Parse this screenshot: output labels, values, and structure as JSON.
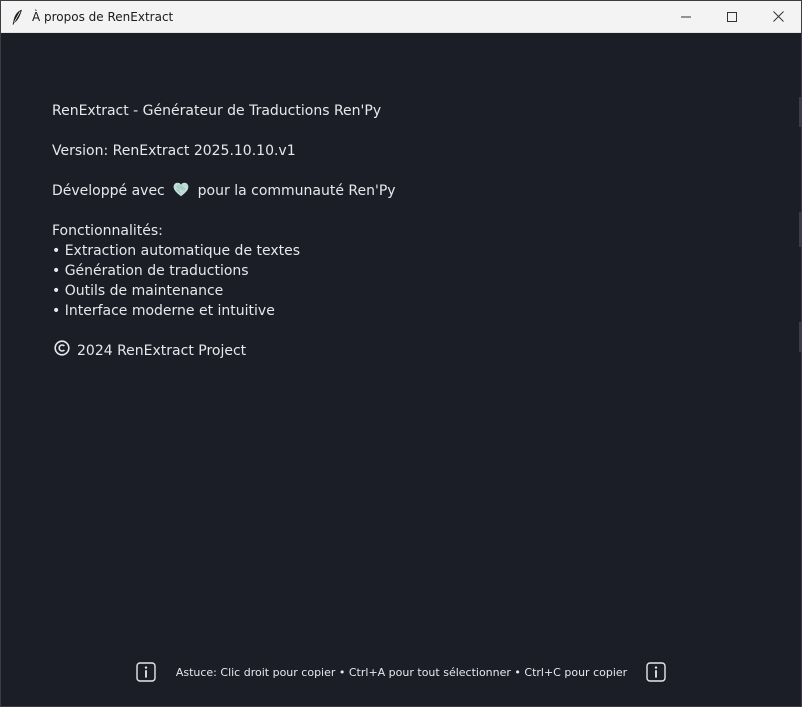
{
  "window": {
    "title": "À propos de RenExtract"
  },
  "about": {
    "heading": "RenExtract - Générateur de Traductions Ren'Py",
    "version": "Version: RenExtract 2025.10.10.v1",
    "dev_prefix": "Développé avec",
    "dev_suffix": "pour la communauté Ren'Py",
    "features_title": "Fonctionnalités:",
    "features": [
      "• Extraction automatique de textes",
      "• Génération de traductions",
      "• Outils de maintenance",
      "• Interface moderne et intuitive"
    ],
    "copyright": "2024 RenExtract Project"
  },
  "footer": {
    "tip": "Astuce: Clic droit pour copier • Ctrl+A pour tout sélectionner • Ctrl+C pour copier"
  },
  "colors": {
    "background": "#1b1e26",
    "text": "#e6e8ec",
    "titlebar": "#f3f3f3",
    "heart": "#bfe0d9"
  }
}
